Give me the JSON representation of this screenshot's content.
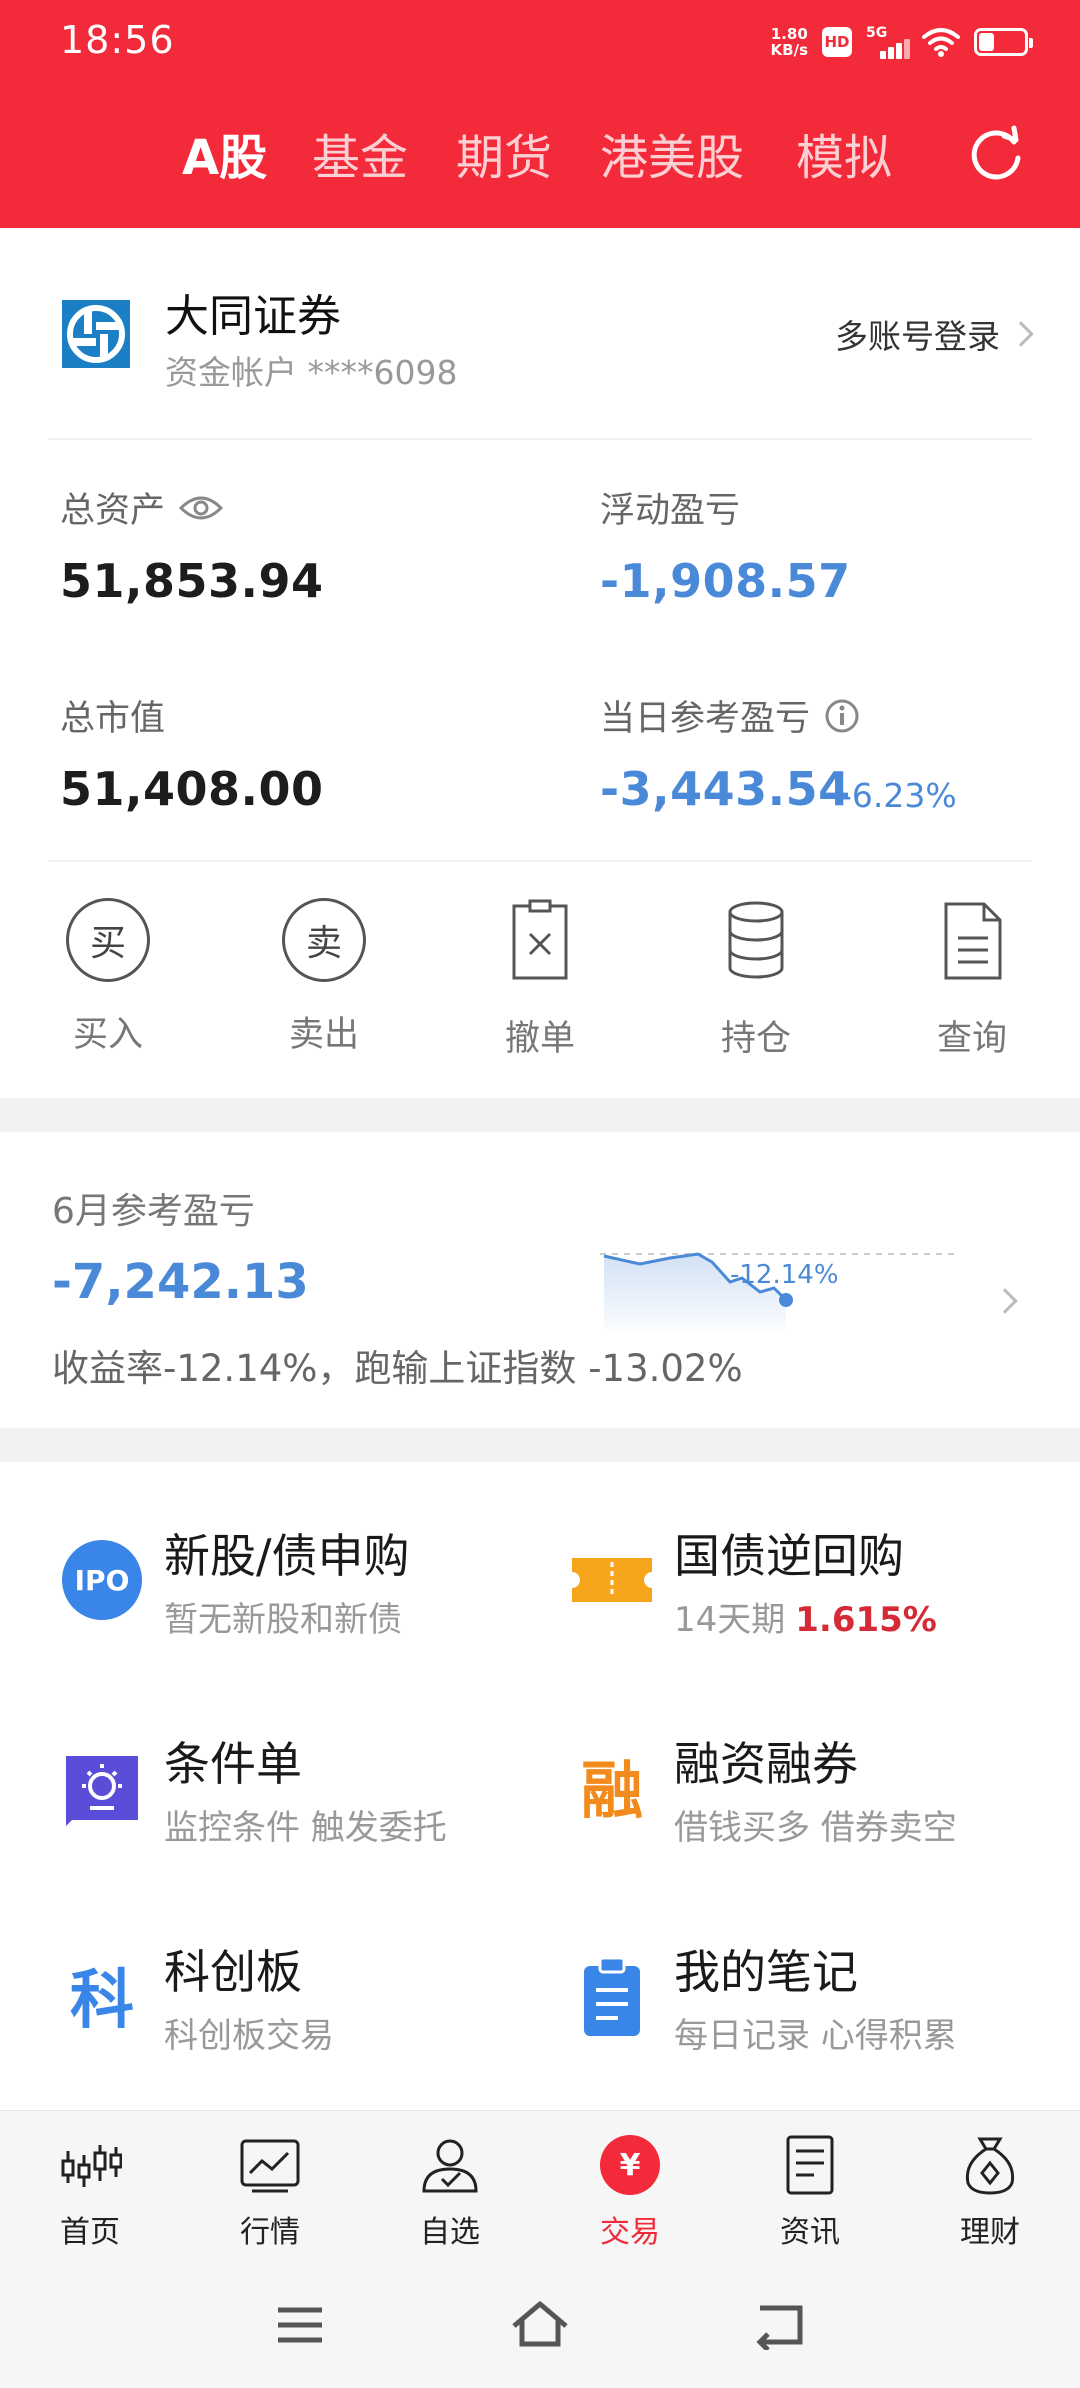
{
  "status_bar": {
    "time": "18:56",
    "net_speed_top": "1.80",
    "net_speed_bottom": "KB/s",
    "hd": "HD",
    "network": "5G",
    "battery_level": 0.35
  },
  "top_tabs": [
    {
      "label": "A股",
      "active": true
    },
    {
      "label": "基金",
      "active": false
    },
    {
      "label": "期货",
      "active": false
    },
    {
      "label": "港美股",
      "active": false
    },
    {
      "label": "模拟",
      "active": false
    }
  ],
  "account": {
    "broker_name": "大同证券",
    "account_label": "资金帐户 ****6098",
    "multi_login": "多账号登录"
  },
  "metrics": {
    "total_assets_label": "总资产",
    "total_assets_value": "51,853.94",
    "floating_pnl_label": "浮动盈亏",
    "floating_pnl_value": "-1,908.57",
    "market_value_label": "总市值",
    "market_value_value": "51,408.00",
    "daily_pnl_label": "当日参考盈亏",
    "daily_pnl_value": "-3,443.54",
    "daily_pnl_pct": "-6.23%"
  },
  "actions": [
    {
      "label": "买入",
      "icon_text": "买",
      "icon": "buy-icon"
    },
    {
      "label": "卖出",
      "icon_text": "卖",
      "icon": "sell-icon"
    },
    {
      "label": "撤单",
      "icon": "cancel-order-icon"
    },
    {
      "label": "持仓",
      "icon": "positions-icon"
    },
    {
      "label": "查询",
      "icon": "query-icon"
    }
  ],
  "monthly": {
    "title": "6月参考盈亏",
    "value": "-7,242.13",
    "sparkline_label": "-12.14%",
    "desc": "收益率-12.14%，跑输上证指数 -13.02%"
  },
  "services": [
    {
      "title": "新股/债申购",
      "sub": "暂无新股和新债",
      "icon": "ipo-icon",
      "icon_text": "IPO"
    },
    {
      "title": "国债逆回购",
      "sub": "14天期",
      "rate": "1.615%",
      "icon": "ticket-icon"
    },
    {
      "title": "条件单",
      "sub": "监控条件 触发委托",
      "icon": "condition-order-icon"
    },
    {
      "title": "融资融券",
      "sub": "借钱买多 借券卖空",
      "icon": "margin-icon",
      "icon_text": "融"
    },
    {
      "title": "科创板",
      "sub": "科创板交易",
      "icon": "star-market-icon",
      "icon_text": "科"
    },
    {
      "title": "我的笔记",
      "sub": "每日记录 心得积累",
      "icon": "notes-icon"
    }
  ],
  "bottom_nav": [
    {
      "label": "首页",
      "active": false
    },
    {
      "label": "行情",
      "active": false
    },
    {
      "label": "自选",
      "active": false
    },
    {
      "label": "交易",
      "active": true,
      "icon_text": "¥"
    },
    {
      "label": "资讯",
      "active": false
    },
    {
      "label": "理财",
      "active": false
    }
  ],
  "colors": {
    "brand_red": "#f22a3a",
    "loss_blue": "#4a88d8",
    "rate_red": "#d42b36"
  }
}
